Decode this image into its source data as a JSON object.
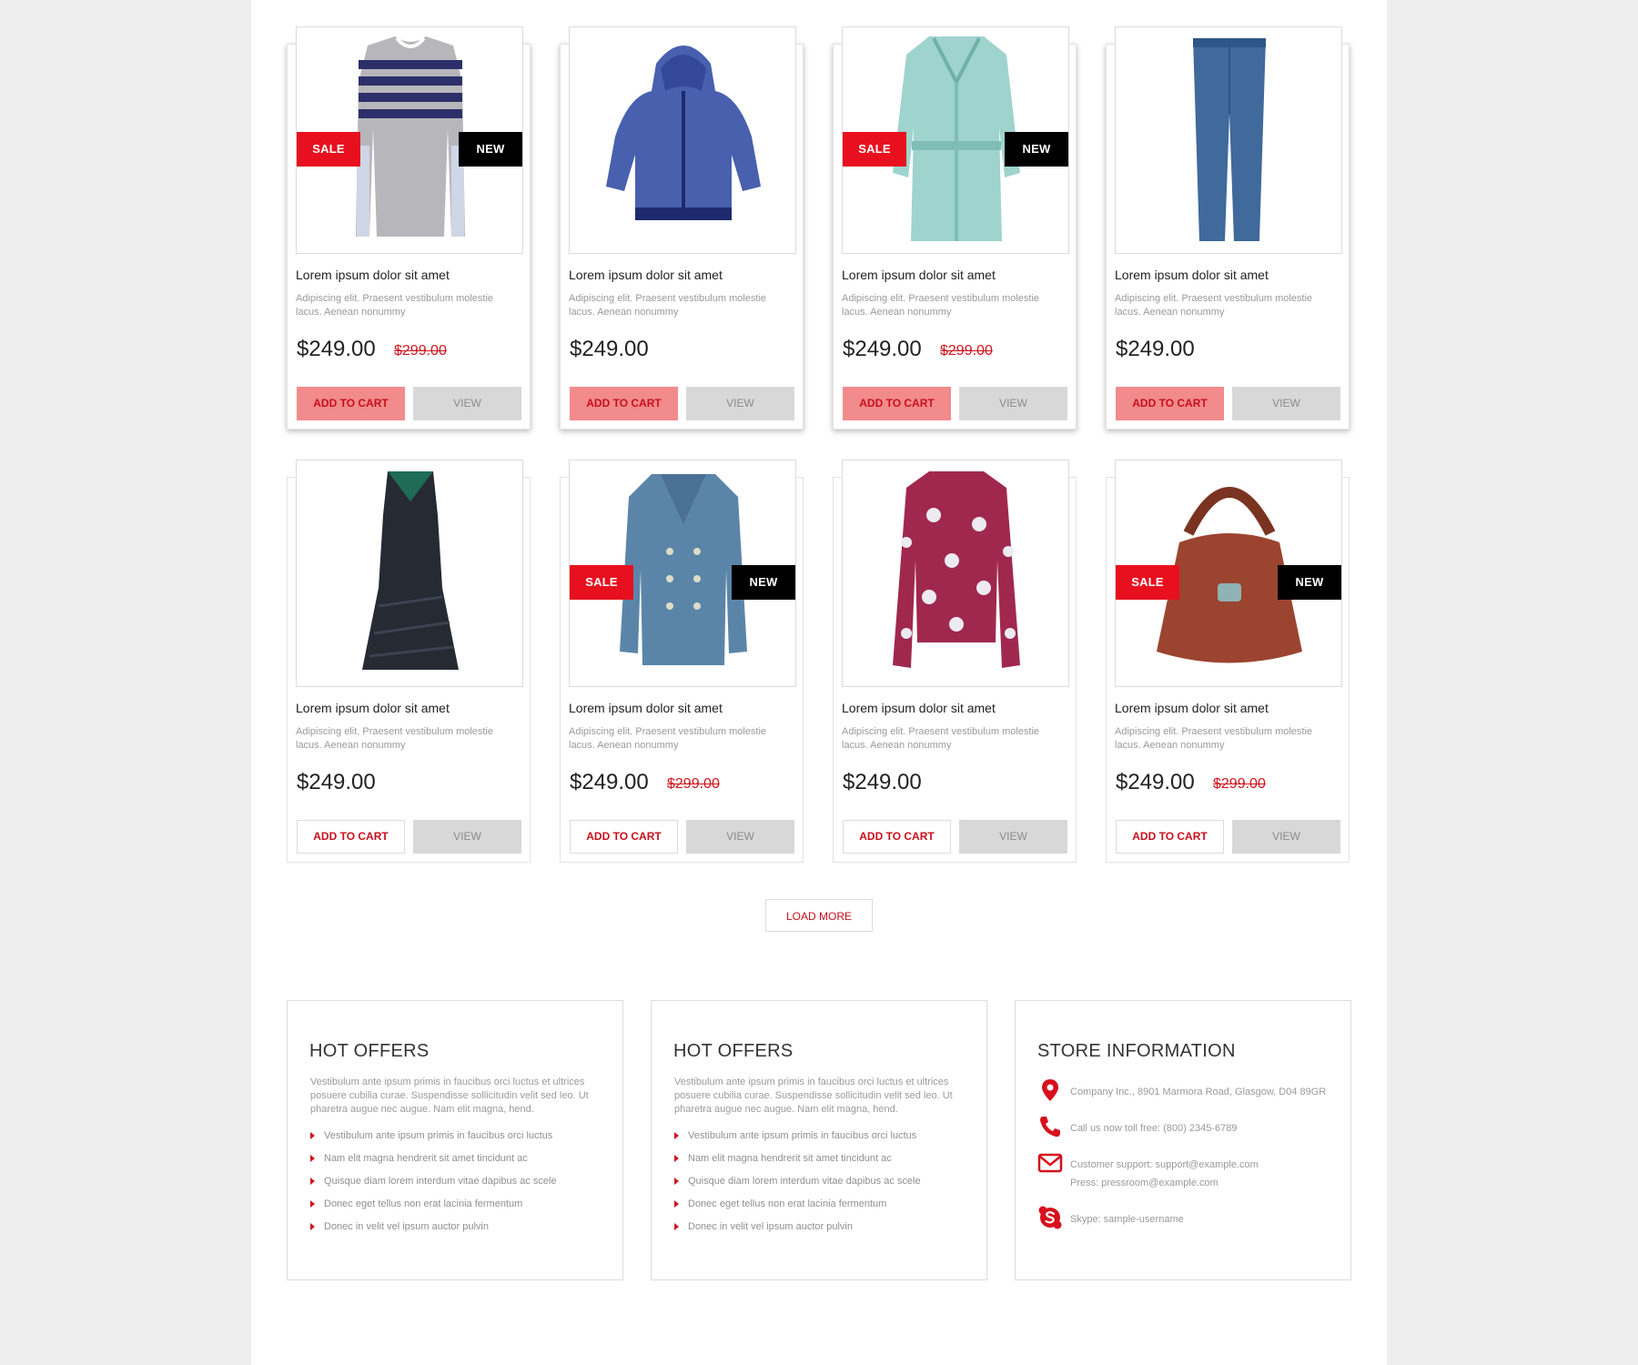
{
  "colors": {
    "accent": "#e8101e",
    "accent_text": "#c8101c",
    "new_badge": "#000000",
    "cart_fill": "#f28b8b",
    "view_fill": "#d8d8d8"
  },
  "products": [
    {
      "image": "striped-sweater",
      "title": "Lorem ipsum dolor sit amet",
      "desc": "Adipiscing elit. Praesent vestibulum molestie lacus. Aenean nonummy",
      "price": "$249.00",
      "old_price": "$299.00",
      "sale": "SALE",
      "new": "NEW",
      "cart": "ADD TO CART",
      "view": "VIEW"
    },
    {
      "image": "blue-hoodie",
      "title": "Lorem ipsum dolor sit amet",
      "desc": "Adipiscing elit. Praesent vestibulum molestie lacus. Aenean nonummy",
      "price": "$249.00",
      "old_price": "",
      "sale": "",
      "new": "",
      "cart": "ADD TO CART",
      "view": "VIEW"
    },
    {
      "image": "mint-trench-coat",
      "title": "Lorem ipsum dolor sit amet",
      "desc": "Adipiscing elit. Praesent vestibulum molestie lacus. Aenean nonummy",
      "price": "$249.00",
      "old_price": "$299.00",
      "sale": "SALE",
      "new": "NEW",
      "cart": "ADD TO CART",
      "view": "VIEW"
    },
    {
      "image": "blue-jeans",
      "title": "Lorem ipsum dolor sit amet",
      "desc": "Adipiscing elit. Praesent vestibulum molestie lacus. Aenean nonummy",
      "price": "$249.00",
      "old_price": "",
      "sale": "",
      "new": "",
      "cart": "ADD TO CART",
      "view": "VIEW"
    },
    {
      "image": "black-dress",
      "title": "Lorem ipsum dolor sit amet",
      "desc": "Adipiscing elit. Praesent vestibulum molestie lacus. Aenean nonummy",
      "price": "$249.00",
      "old_price": "",
      "sale": "",
      "new": "",
      "cart": "ADD TO CART",
      "view": "VIEW"
    },
    {
      "image": "pea-coat",
      "title": "Lorem ipsum dolor sit amet",
      "desc": "Adipiscing elit. Praesent vestibulum molestie lacus. Aenean nonummy",
      "price": "$249.00",
      "old_price": "$299.00",
      "sale": "SALE",
      "new": "NEW",
      "cart": "ADD TO CART",
      "view": "VIEW"
    },
    {
      "image": "floral-blouse",
      "title": "Lorem ipsum dolor sit amet",
      "desc": "Adipiscing elit. Praesent vestibulum molestie lacus. Aenean nonummy",
      "price": "$249.00",
      "old_price": "",
      "sale": "",
      "new": "",
      "cart": "ADD TO CART",
      "view": "VIEW"
    },
    {
      "image": "leather-handbag",
      "title": "Lorem ipsum dolor sit amet",
      "desc": "Adipiscing elit. Praesent vestibulum molestie lacus. Aenean nonummy",
      "price": "$249.00",
      "old_price": "$299.00",
      "sale": "SALE",
      "new": "NEW",
      "cart": "ADD TO CART",
      "view": "VIEW"
    }
  ],
  "load_more": "LOAD MORE",
  "offers": [
    {
      "title": "HOT OFFERS",
      "intro": "Vestibulum ante ipsum primis in faucibus orci luctus et ultrices posuere cubilia curae. Suspendisse sollicitudin velit sed leo. Ut pharetra augue nec augue. Nam elit magna, hend.",
      "items": [
        "Vestibulum ante ipsum primis in faucibus orci luctus",
        "Nam elit magna hendrerit sit amet tincidunt ac",
        "Quisque diam lorem interdum vitae dapibus ac scele",
        "Donec eget tellus non erat lacinia fermentum",
        "Donec in velit vel ipsum auctor pulvin"
      ]
    },
    {
      "title": "HOT OFFERS",
      "intro": "Vestibulum ante ipsum primis in faucibus orci luctus et ultrices posuere cubilia curae. Suspendisse sollicitudin velit sed leo. Ut pharetra augue nec augue. Nam elit magna, hend.",
      "items": [
        "Vestibulum ante ipsum primis in faucibus orci luctus",
        "Nam elit magna hendrerit sit amet tincidunt ac",
        "Quisque diam lorem interdum vitae dapibus ac scele",
        "Donec eget tellus non erat lacinia fermentum",
        "Donec in velit vel ipsum auctor pulvin"
      ]
    }
  ],
  "store": {
    "title": "STORE INFORMATION",
    "address": "Company Inc., 8901 Marmora Road, Glasgow, D04 89GR",
    "phone": "Call us now toll free: (800) 2345-6789",
    "support": "Customer support: support@example.com",
    "press": "Press: pressroom@example.com",
    "skype": "Skype: sample-username",
    "icons": [
      "map-pin-icon",
      "phone-icon",
      "envelope-icon",
      "skype-icon"
    ]
  }
}
